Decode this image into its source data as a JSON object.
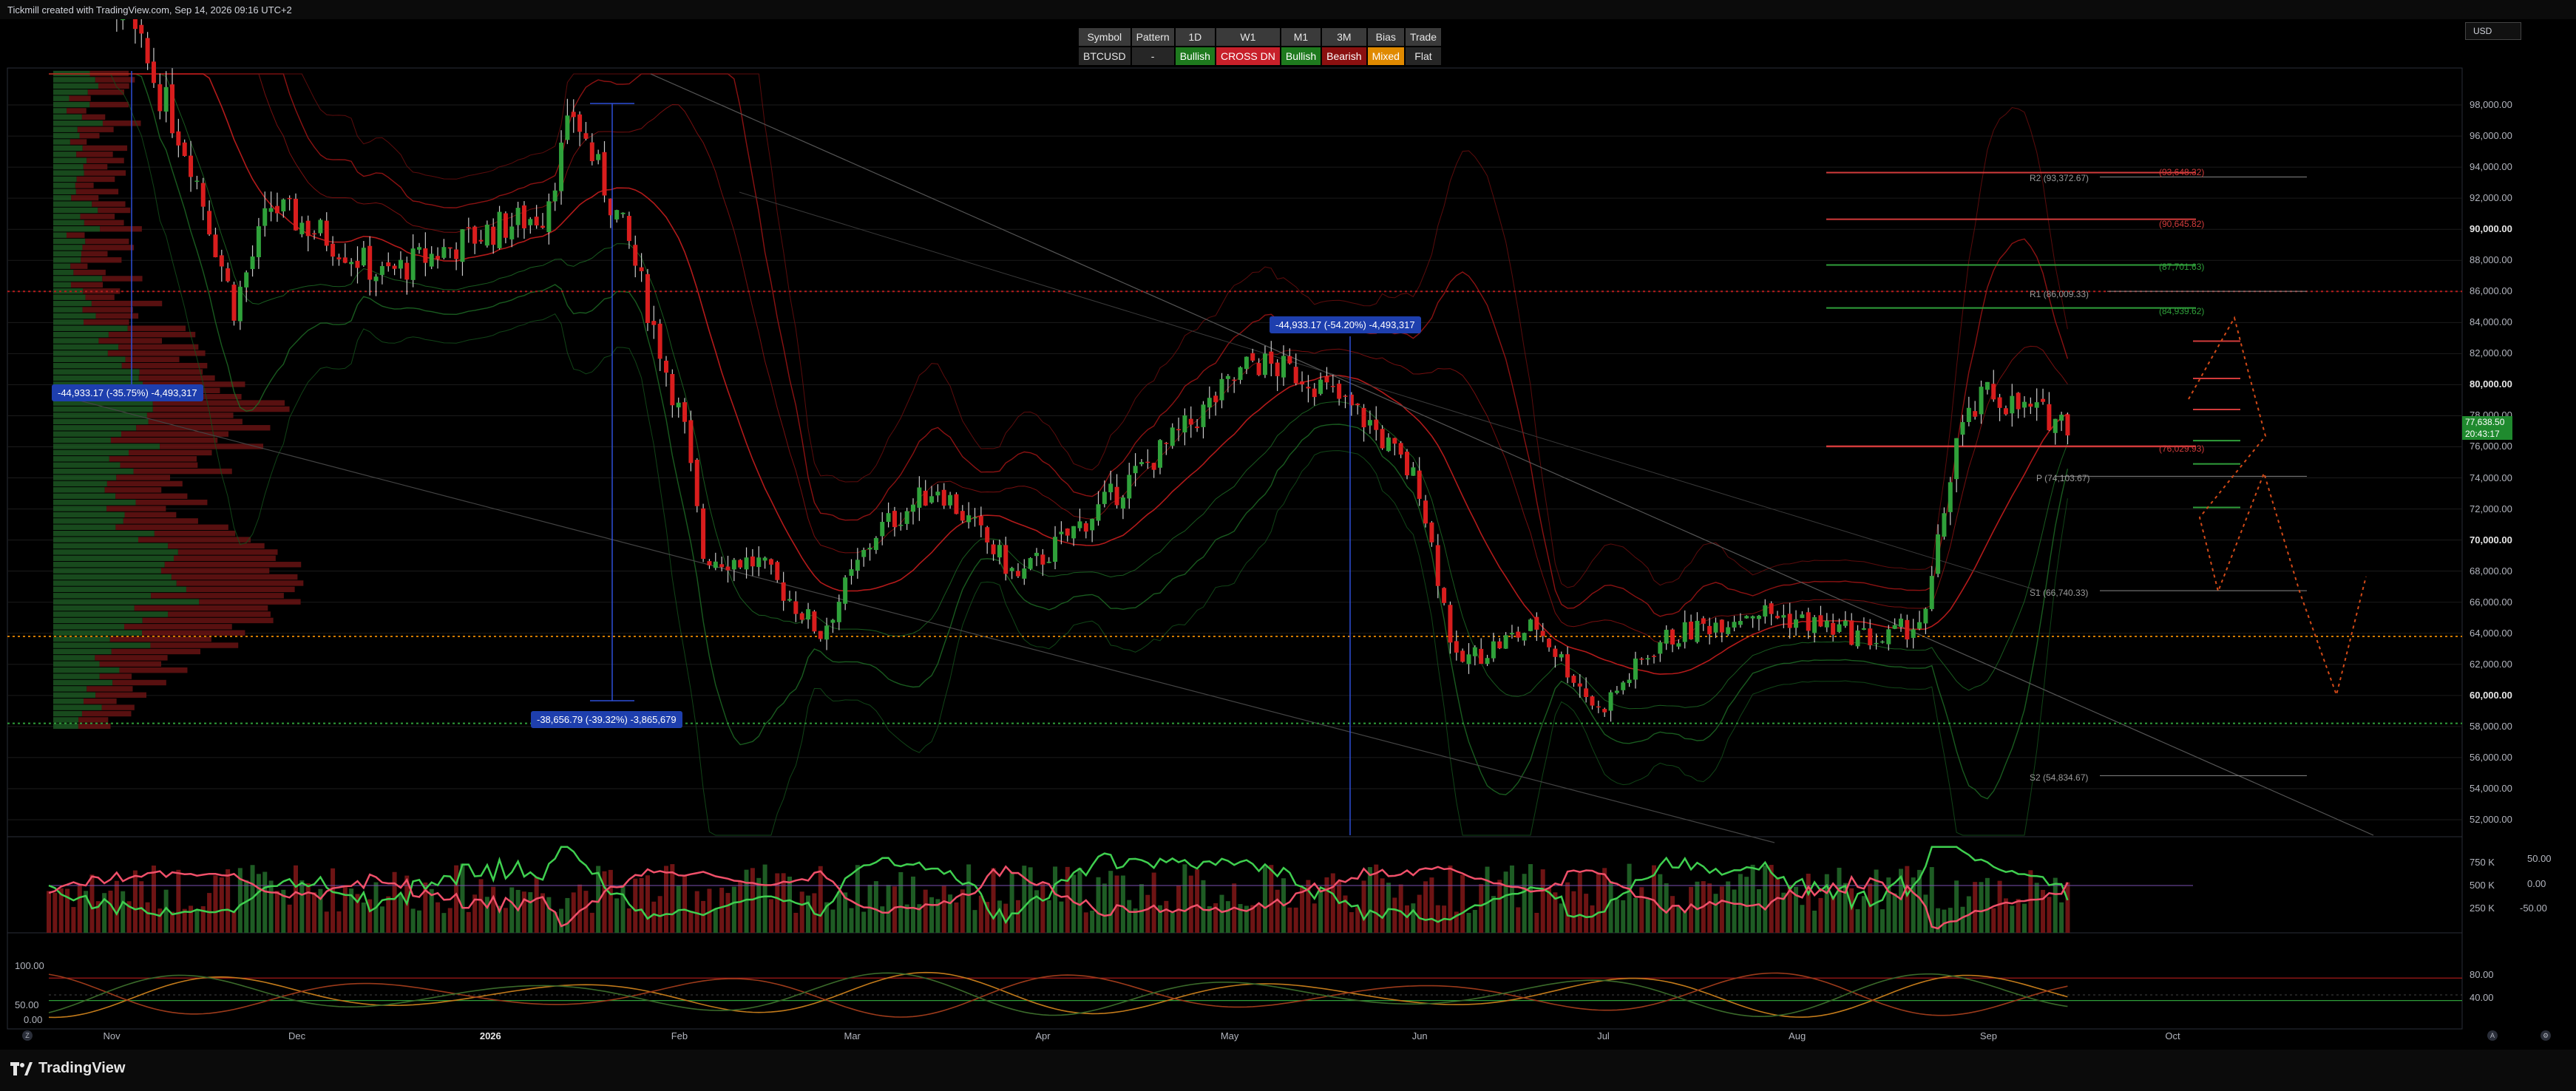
{
  "header": {
    "credit": "Tickmill created with TradingView.com, Sep 14, 2026 09:16 UTC+2",
    "currency": "USD"
  },
  "bias_table": {
    "headers": [
      "Symbol",
      "Pattern",
      "1D",
      "W1",
      "M1",
      "3M",
      "Bias",
      "Trade"
    ],
    "values": [
      "BTCUSD",
      "-",
      "Bullish",
      "CROSS DN",
      "Bullish",
      "Bearish",
      "Mixed",
      "Flat"
    ]
  },
  "price_axis": {
    "ticks": [
      "98,000.00",
      "96,000.00",
      "94,000.00",
      "92,000.00",
      "90,000.00",
      "88,000.00",
      "86,000.00",
      "84,000.00",
      "82,000.00",
      "80,000.00",
      "78,000.00",
      "76,000.00",
      "74,000.00",
      "72,000.00",
      "70,000.00",
      "68,000.00",
      "66,000.00",
      "64,000.00",
      "62,000.00",
      "60,000.00",
      "58,000.00",
      "56,000.00",
      "54,000.00",
      "52,000.00"
    ],
    "bold_ticks": [
      "90,000.00",
      "80,000.00",
      "70,000.00",
      "60,000.00"
    ],
    "last_price": "77,638.50",
    "countdown": "20:43:17"
  },
  "time_axis": [
    "Nov",
    "Dec",
    "2026",
    "Feb",
    "Mar",
    "Apr",
    "May",
    "Jun",
    "Jul",
    "Aug",
    "Sep",
    "Oct"
  ],
  "pivots": {
    "r2": "R2 (93,372.67)",
    "r2_ext": "(93,648.32)",
    "r1": "R1 (86,009.33)",
    "pp": "P (74,103.67)",
    "s1": "S1 (66,740.33)",
    "s2": "S2 (54,834.67)",
    "lvl_90": "(90,645.82)",
    "lvl_87": "(87,701.63)",
    "lvl_84": "(84,939.62)",
    "lvl_76": "(76,029.93)"
  },
  "measures": {
    "left": "-44,933.17 (-35.75%) -4,493,317",
    "bottom": "-38,656.79 (-39.32%) -3,865,679",
    "mid": "-44,933.17 (-54.20%) -4,493,317"
  },
  "volume_axis": [
    "750 K",
    "500 K",
    "250 K"
  ],
  "osc1_axis": [
    "50.00",
    "0.00",
    "-50.00"
  ],
  "osc2_left": [
    "100.00",
    "50.00",
    "0.00"
  ],
  "osc2_right": [
    "80.00",
    "40.00"
  ],
  "footer": {
    "brand": "TradingView"
  },
  "colors": {
    "up": "#1f8a2e",
    "down": "#c61a1a",
    "bg": "#000000",
    "grid": "#1b1b1b",
    "badge": "#1e3fae"
  },
  "chart_data": {
    "type": "candlestick",
    "symbol": "BTCUSD",
    "ylim": [
      51000,
      100000
    ],
    "anchors": [
      {
        "date": "2025-10-20",
        "close": 113000
      },
      {
        "date": "2025-11-03",
        "close": 104000
      },
      {
        "date": "2025-11-14",
        "close": 94500
      },
      {
        "date": "2025-11-21",
        "close": 85000
      },
      {
        "date": "2025-11-27",
        "close": 91500
      },
      {
        "date": "2025-12-06",
        "close": 89500
      },
      {
        "date": "2025-12-15",
        "close": 87000
      },
      {
        "date": "2025-12-24",
        "close": 88500
      },
      {
        "date": "2026-01-02",
        "close": 90000
      },
      {
        "date": "2026-01-10",
        "close": 91000
      },
      {
        "date": "2026-01-15",
        "close": 97500
      },
      {
        "date": "2026-01-24",
        "close": 89000
      },
      {
        "date": "2026-02-02",
        "close": 77000
      },
      {
        "date": "2026-02-05",
        "close": 69000
      },
      {
        "date": "2026-02-14",
        "close": 68500
      },
      {
        "date": "2026-02-24",
        "close": 64000
      },
      {
        "date": "2026-03-05",
        "close": 70500
      },
      {
        "date": "2026-03-15",
        "close": 73500
      },
      {
        "date": "2026-03-28",
        "close": 67500
      },
      {
        "date": "2026-04-10",
        "close": 72000
      },
      {
        "date": "2026-04-25",
        "close": 77500
      },
      {
        "date": "2026-05-05",
        "close": 81500
      },
      {
        "date": "2026-05-14",
        "close": 80500
      },
      {
        "date": "2026-05-24",
        "close": 77500
      },
      {
        "date": "2026-06-01",
        "close": 73500
      },
      {
        "date": "2026-06-07",
        "close": 62000
      },
      {
        "date": "2026-06-20",
        "close": 64500
      },
      {
        "date": "2026-06-30",
        "close": 59000
      },
      {
        "date": "2026-07-10",
        "close": 63500
      },
      {
        "date": "2026-07-25",
        "close": 65500
      },
      {
        "date": "2026-08-05",
        "close": 64500
      },
      {
        "date": "2026-08-15",
        "close": 63500
      },
      {
        "date": "2026-08-22",
        "close": 65000
      },
      {
        "date": "2026-08-27",
        "close": 76500
      },
      {
        "date": "2026-09-01",
        "close": 79500
      },
      {
        "date": "2026-09-06",
        "close": 78500
      },
      {
        "date": "2026-09-14",
        "close": 77638
      }
    ],
    "horizontal_levels": [
      86000,
      63800,
      58200
    ],
    "volume_ylim": [
      0,
      1000000
    ],
    "oscillator_ylim": [
      -100,
      100
    ],
    "stochastic_ylim": [
      0,
      100
    ]
  }
}
